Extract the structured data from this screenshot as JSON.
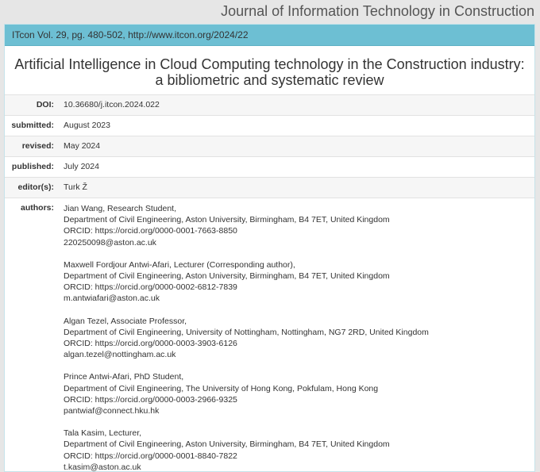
{
  "header": {
    "journal_name": "Journal of Information Technology in Construction"
  },
  "panel": {
    "citation": "ITcon Vol. 29, pg. 480-502, http://www.itcon.org/2024/22"
  },
  "article": {
    "title": "Artificial Intelligence in Cloud Computing technology in the Construction industry: a bibliometric and systematic review"
  },
  "meta": [
    {
      "label": "DOI:",
      "value": "10.36680/j.itcon.2024.022"
    },
    {
      "label": "submitted:",
      "value": "August 2023"
    },
    {
      "label": "revised:",
      "value": "May 2024"
    },
    {
      "label": "published:",
      "value": "July 2024"
    },
    {
      "label": "editor(s):",
      "value": "Turk Ž"
    }
  ],
  "authors_label": "authors:",
  "authors": [
    {
      "name": "Jian Wang, Research Student,",
      "affiliation": "Department of Civil Engineering, Aston University, Birmingham, B4 7ET, United Kingdom",
      "orcid": "ORCID: https://orcid.org/0000-0001-7663-8850",
      "email": "220250098@aston.ac.uk"
    },
    {
      "name": "Maxwell Fordjour Antwi-Afari, Lecturer (Corresponding author),",
      "affiliation": "Department of Civil Engineering, Aston University, Birmingham, B4 7ET, United Kingdom",
      "orcid": "ORCID: https://orcid.org/0000-0002-6812-7839",
      "email": "m.antwiafari@aston.ac.uk"
    },
    {
      "name": "Algan Tezel, Associate Professor,",
      "affiliation": "Department of Civil Engineering, University of Nottingham, Nottingham, NG7 2RD, United Kingdom",
      "orcid": "ORCID: https://orcid.org/0000-0003-3903-6126",
      "email": "algan.tezel@nottingham.ac.uk"
    },
    {
      "name": "Prince Antwi-Afari, PhD Student,",
      "affiliation": "Department of Civil Engineering, The University of Hong Kong, Pokfulam, Hong Kong",
      "orcid": "ORCID: https://orcid.org/0000-0003-2966-9325",
      "email": "pantwiaf@connect.hku.hk"
    },
    {
      "name": "Tala Kasim, Lecturer,",
      "affiliation": "Department of Civil Engineering, Aston University, Birmingham, B4 7ET, United Kingdom",
      "orcid": "ORCID: https://orcid.org/0000-0001-8840-7822",
      "email": "t.kasim@aston.ac.uk"
    }
  ]
}
